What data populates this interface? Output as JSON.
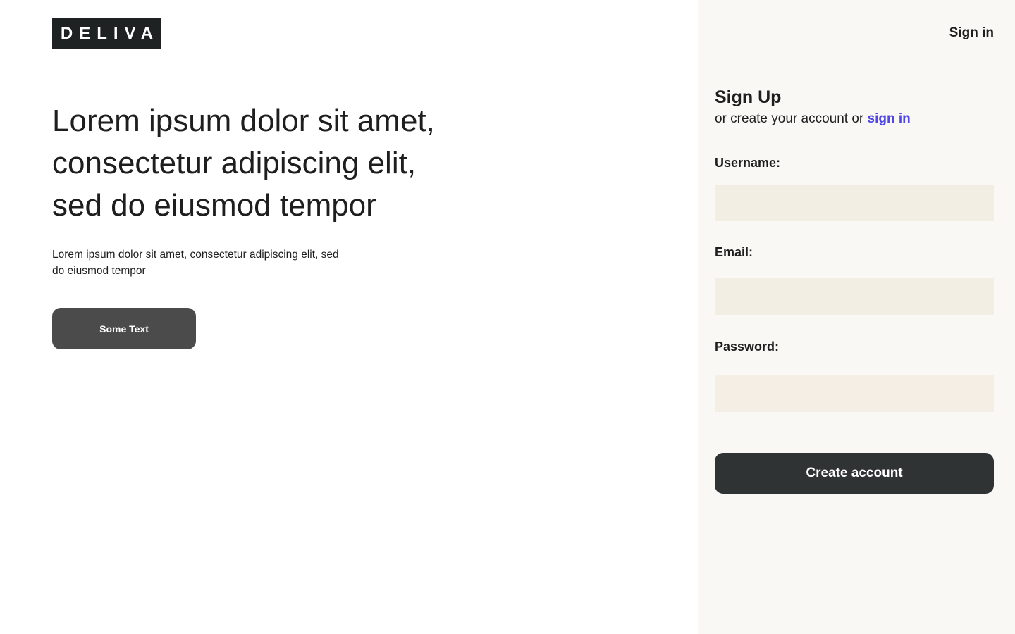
{
  "brand": {
    "logo_text": "DELIVA"
  },
  "hero": {
    "title_line1": "Lorem ipsum dolor sit amet,",
    "title_line2": "consectetur adipiscing elit,",
    "title_line3": "sed do eiusmod tempor",
    "subtitle_line1": "Lorem ipsum dolor sit amet, consectetur adipiscing elit, sed",
    "subtitle_line2": "do eiusmod tempor",
    "cta_label": "Some Text"
  },
  "header": {
    "signin_label": "Sign in"
  },
  "signup": {
    "title": "Sign Up",
    "subtitle_prefix": "or create your account or ",
    "subtitle_link": "sign in",
    "fields": [
      {
        "label": "Username:",
        "value": "",
        "placeholder": ""
      },
      {
        "label": "Email:",
        "value": "",
        "placeholder": ""
      },
      {
        "label": "Password:",
        "value": "",
        "placeholder": ""
      }
    ],
    "submit_label": "Create account"
  },
  "colors": {
    "logo_bg": "#1f2223",
    "cta_bg": "#4a4b4a",
    "panel_bg": "#faf8f4",
    "input_bg": "#f2eee4",
    "link_accent": "#4f46e5",
    "submit_bg": "#303333"
  }
}
